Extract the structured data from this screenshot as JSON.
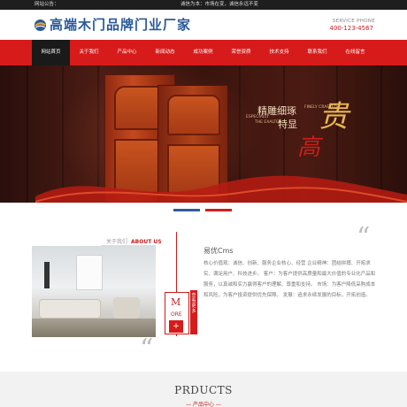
{
  "topbar": {
    "notice_label": "网站公告：",
    "notice_text": "诚信为本：市场在变，诚信永远不变"
  },
  "header": {
    "site_name": "高端木门品牌门业厂家",
    "service_label": "SERVICE PHONE",
    "service_phone": "400-123-4567"
  },
  "nav": {
    "items": [
      {
        "label": "网站首页",
        "active": true
      },
      {
        "label": "关于我们"
      },
      {
        "label": "产品中心"
      },
      {
        "label": "新闻动态"
      },
      {
        "label": "成功案例"
      },
      {
        "label": "荣誉资质"
      },
      {
        "label": "技术支持"
      },
      {
        "label": "联系我们"
      },
      {
        "label": "在线留言"
      }
    ]
  },
  "banner": {
    "slogan_line1": "精雕细琢",
    "slogan_line2": "特显",
    "slogan_en1": "ESPECIALLY",
    "slogan_en2": "THE EXALTED",
    "slogan_en3": "FINELY CRAFTED",
    "char_big": "贵",
    "char_seal": "高"
  },
  "about": {
    "tagline_cn": "关于我们",
    "tagline_en": "ABOUT US",
    "more_m": "M",
    "more_ore": "ORE",
    "more_plus": "+",
    "more_vertical": "查看更多",
    "quote_open": "“",
    "quote_close": "“",
    "company_name": "易优Cms",
    "description": "核心价值观：诚信、创新、服务企业核心、经营 企业精神：团结拼搏、开拓求实、满足用户、科技进步。 客户：为客户提供高质量和最大价值的专业化产品和服务，以真诚和实力赢得客户的理解、尊重和支持。 市场：为客户降低采购成本和风险，为客户投资提供优先保障。 发展：追求永续发展的目标，开拓创造。"
  },
  "products": {
    "title": "PRDUCTS",
    "subtitle": "— 产品中心 —"
  },
  "colors": {
    "accent_red": "#d71b1b",
    "brand_blue": "#2a5a9a"
  }
}
